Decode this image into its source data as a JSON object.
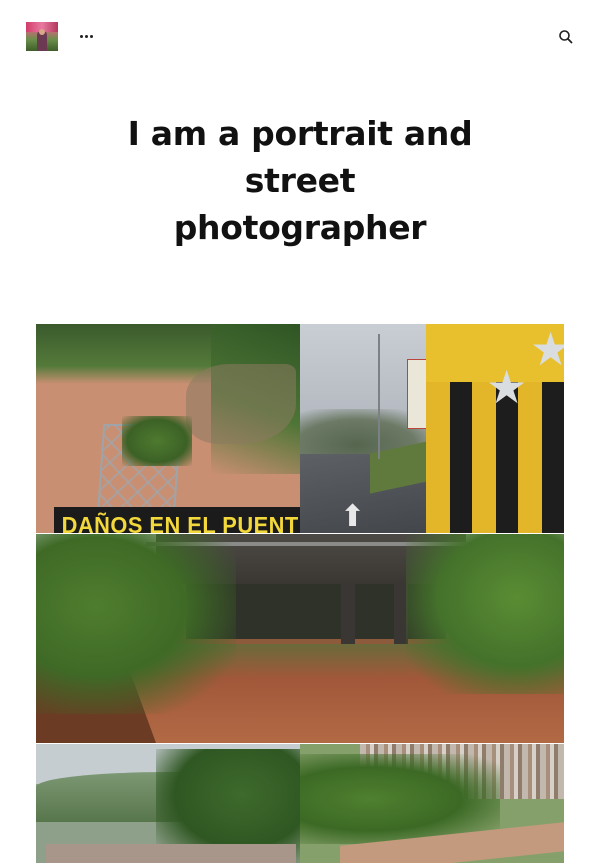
{
  "header": {
    "menu_icon": "ellipsis-icon",
    "search_icon": "search-icon"
  },
  "hero": {
    "title": "I am a portrait and street photographer"
  },
  "gallery": {
    "images": [
      {
        "caption": "DAÑOS EN EL PUENTE"
      },
      {
        "caption": ""
      },
      {
        "caption": ""
      },
      {
        "caption": ""
      },
      {
        "caption": ""
      }
    ]
  },
  "colors": {
    "background": "#ffffff",
    "text": "#111111",
    "caption_bg": "#1b1b1b",
    "caption_text": "#f2d83b"
  }
}
